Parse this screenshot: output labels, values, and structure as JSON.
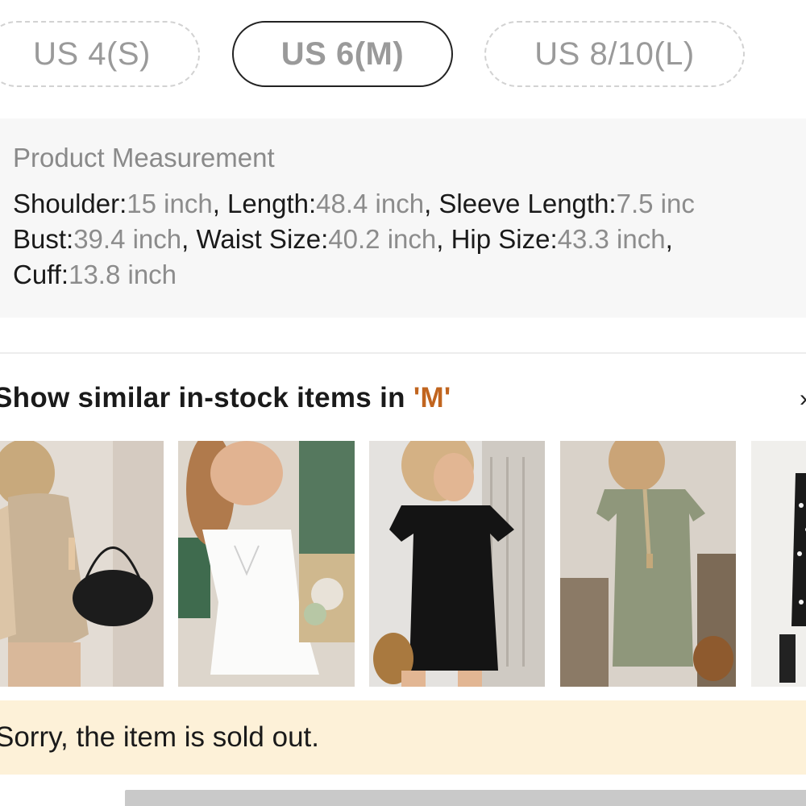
{
  "sizes": [
    {
      "label": "US 4(S)",
      "selected": false
    },
    {
      "label": "US 6(M)",
      "selected": true
    },
    {
      "label": "US 8/10(L)",
      "selected": false
    }
  ],
  "measurement": {
    "title": "Product Measurement",
    "items": [
      {
        "key": "Shoulder:",
        "value": "15 inch"
      },
      {
        "key": "Length:",
        "value": "48.4 inch"
      },
      {
        "key": "Sleeve Length:",
        "value": "7.5 inc"
      },
      {
        "key": "Bust:",
        "value": "39.4 inch"
      },
      {
        "key": "Waist Size:",
        "value": "40.2 inch"
      },
      {
        "key": "Hip Size:",
        "value": "43.3 inch"
      },
      {
        "key": "Cuff:",
        "value": "13.8 inch"
      }
    ]
  },
  "similar": {
    "prefix": "Show similar in-stock items in ",
    "size": "'M'",
    "accent_color": "#c1651f",
    "products": [
      {
        "name": "beige knit bodycon dress"
      },
      {
        "name": "white smocked cami dress"
      },
      {
        "name": "black short sleeve t-shirt dress"
      },
      {
        "name": "olive button front dress"
      },
      {
        "name": "black polka dot dress"
      }
    ]
  },
  "status": {
    "sold_out_text": "Sorry, the item is sold out.",
    "banner_color": "#fdf1d8"
  }
}
